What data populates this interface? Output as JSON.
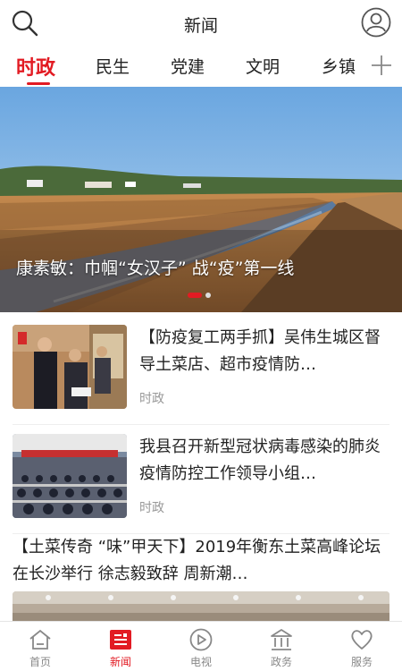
{
  "header": {
    "title": "新闻",
    "search_icon": "search-icon",
    "profile_icon": "user-icon"
  },
  "tabs": {
    "items": [
      {
        "label": "时政",
        "active": true
      },
      {
        "label": "民生",
        "active": false
      },
      {
        "label": "党建",
        "active": false
      },
      {
        "label": "文明",
        "active": false
      },
      {
        "label": "乡镇",
        "active": false
      }
    ],
    "add_icon": "plus-icon",
    "accent_color": "#e21b23"
  },
  "banner": {
    "caption": "康素敏：巾帼“女汉子” 战“疫”第一线",
    "slides_total": 2,
    "slide_active": 1
  },
  "news": [
    {
      "title": "【防疫复工两手抓】吴伟生城区督导土菜店、超市疫情防…",
      "category": "时政"
    },
    {
      "title": "我县召开新型冠状病毒感染的肺炎疫情防控工作领导小组…",
      "category": "时政"
    }
  ],
  "featured": {
    "title": "【土菜传奇 “味”甲天下】2019年衡东土菜高峰论坛在长沙举行 徐志毅致辞 周新潮…"
  },
  "bottom_nav": {
    "items": [
      {
        "label": "首页",
        "icon": "home-icon",
        "active": false
      },
      {
        "label": "新闻",
        "icon": "news-icon",
        "active": true
      },
      {
        "label": "电视",
        "icon": "play-icon",
        "active": false
      },
      {
        "label": "政务",
        "icon": "government-icon",
        "active": false
      },
      {
        "label": "服务",
        "icon": "heart-icon",
        "active": false
      }
    ]
  }
}
